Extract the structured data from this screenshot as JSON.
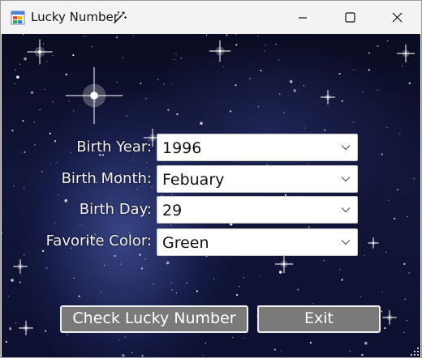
{
  "window": {
    "title": "Lucky Number",
    "app_icon": "windows-forms-icon",
    "title_icon": "magic-wand-icon",
    "caption_buttons": [
      "minimize-icon",
      "maximize-icon",
      "close-icon"
    ]
  },
  "form": {
    "fields": [
      {
        "label": "Birth Year:",
        "value": "1996"
      },
      {
        "label": "Birth Month:",
        "value": "Febuary"
      },
      {
        "label": "Birth Day:",
        "value": "29"
      },
      {
        "label": "Favorite Color:",
        "value": "Green"
      }
    ],
    "check_button": "Check Lucky Number",
    "exit_button": "Exit"
  },
  "colors": {
    "background_sky": "#0d1030",
    "button_fill": "#7a7a7a",
    "label_text": "#f2f2f2"
  }
}
